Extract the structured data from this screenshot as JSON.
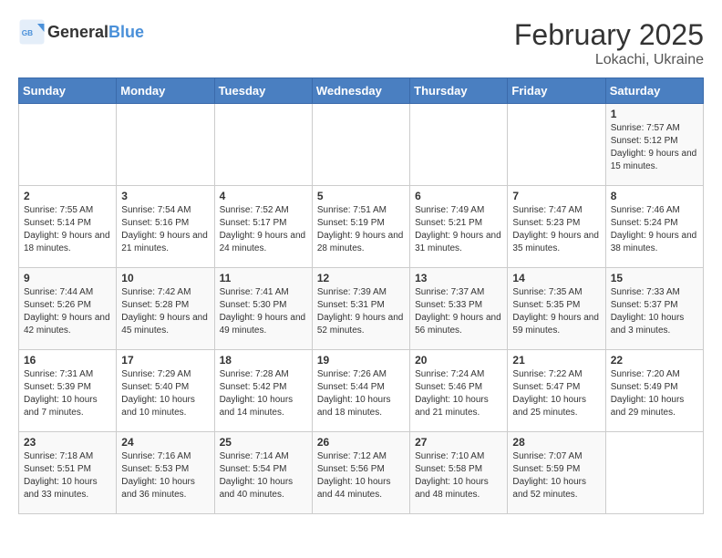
{
  "header": {
    "logo_general": "General",
    "logo_blue": "Blue",
    "month_year": "February 2025",
    "location": "Lokachi, Ukraine"
  },
  "days_of_week": [
    "Sunday",
    "Monday",
    "Tuesday",
    "Wednesday",
    "Thursday",
    "Friday",
    "Saturday"
  ],
  "weeks": [
    [
      {
        "day": "",
        "info": ""
      },
      {
        "day": "",
        "info": ""
      },
      {
        "day": "",
        "info": ""
      },
      {
        "day": "",
        "info": ""
      },
      {
        "day": "",
        "info": ""
      },
      {
        "day": "",
        "info": ""
      },
      {
        "day": "1",
        "info": "Sunrise: 7:57 AM\nSunset: 5:12 PM\nDaylight: 9 hours and 15 minutes."
      }
    ],
    [
      {
        "day": "2",
        "info": "Sunrise: 7:55 AM\nSunset: 5:14 PM\nDaylight: 9 hours and 18 minutes."
      },
      {
        "day": "3",
        "info": "Sunrise: 7:54 AM\nSunset: 5:16 PM\nDaylight: 9 hours and 21 minutes."
      },
      {
        "day": "4",
        "info": "Sunrise: 7:52 AM\nSunset: 5:17 PM\nDaylight: 9 hours and 24 minutes."
      },
      {
        "day": "5",
        "info": "Sunrise: 7:51 AM\nSunset: 5:19 PM\nDaylight: 9 hours and 28 minutes."
      },
      {
        "day": "6",
        "info": "Sunrise: 7:49 AM\nSunset: 5:21 PM\nDaylight: 9 hours and 31 minutes."
      },
      {
        "day": "7",
        "info": "Sunrise: 7:47 AM\nSunset: 5:23 PM\nDaylight: 9 hours and 35 minutes."
      },
      {
        "day": "8",
        "info": "Sunrise: 7:46 AM\nSunset: 5:24 PM\nDaylight: 9 hours and 38 minutes."
      }
    ],
    [
      {
        "day": "9",
        "info": "Sunrise: 7:44 AM\nSunset: 5:26 PM\nDaylight: 9 hours and 42 minutes."
      },
      {
        "day": "10",
        "info": "Sunrise: 7:42 AM\nSunset: 5:28 PM\nDaylight: 9 hours and 45 minutes."
      },
      {
        "day": "11",
        "info": "Sunrise: 7:41 AM\nSunset: 5:30 PM\nDaylight: 9 hours and 49 minutes."
      },
      {
        "day": "12",
        "info": "Sunrise: 7:39 AM\nSunset: 5:31 PM\nDaylight: 9 hours and 52 minutes."
      },
      {
        "day": "13",
        "info": "Sunrise: 7:37 AM\nSunset: 5:33 PM\nDaylight: 9 hours and 56 minutes."
      },
      {
        "day": "14",
        "info": "Sunrise: 7:35 AM\nSunset: 5:35 PM\nDaylight: 9 hours and 59 minutes."
      },
      {
        "day": "15",
        "info": "Sunrise: 7:33 AM\nSunset: 5:37 PM\nDaylight: 10 hours and 3 minutes."
      }
    ],
    [
      {
        "day": "16",
        "info": "Sunrise: 7:31 AM\nSunset: 5:39 PM\nDaylight: 10 hours and 7 minutes."
      },
      {
        "day": "17",
        "info": "Sunrise: 7:29 AM\nSunset: 5:40 PM\nDaylight: 10 hours and 10 minutes."
      },
      {
        "day": "18",
        "info": "Sunrise: 7:28 AM\nSunset: 5:42 PM\nDaylight: 10 hours and 14 minutes."
      },
      {
        "day": "19",
        "info": "Sunrise: 7:26 AM\nSunset: 5:44 PM\nDaylight: 10 hours and 18 minutes."
      },
      {
        "day": "20",
        "info": "Sunrise: 7:24 AM\nSunset: 5:46 PM\nDaylight: 10 hours and 21 minutes."
      },
      {
        "day": "21",
        "info": "Sunrise: 7:22 AM\nSunset: 5:47 PM\nDaylight: 10 hours and 25 minutes."
      },
      {
        "day": "22",
        "info": "Sunrise: 7:20 AM\nSunset: 5:49 PM\nDaylight: 10 hours and 29 minutes."
      }
    ],
    [
      {
        "day": "23",
        "info": "Sunrise: 7:18 AM\nSunset: 5:51 PM\nDaylight: 10 hours and 33 minutes."
      },
      {
        "day": "24",
        "info": "Sunrise: 7:16 AM\nSunset: 5:53 PM\nDaylight: 10 hours and 36 minutes."
      },
      {
        "day": "25",
        "info": "Sunrise: 7:14 AM\nSunset: 5:54 PM\nDaylight: 10 hours and 40 minutes."
      },
      {
        "day": "26",
        "info": "Sunrise: 7:12 AM\nSunset: 5:56 PM\nDaylight: 10 hours and 44 minutes."
      },
      {
        "day": "27",
        "info": "Sunrise: 7:10 AM\nSunset: 5:58 PM\nDaylight: 10 hours and 48 minutes."
      },
      {
        "day": "28",
        "info": "Sunrise: 7:07 AM\nSunset: 5:59 PM\nDaylight: 10 hours and 52 minutes."
      },
      {
        "day": "",
        "info": ""
      }
    ]
  ]
}
